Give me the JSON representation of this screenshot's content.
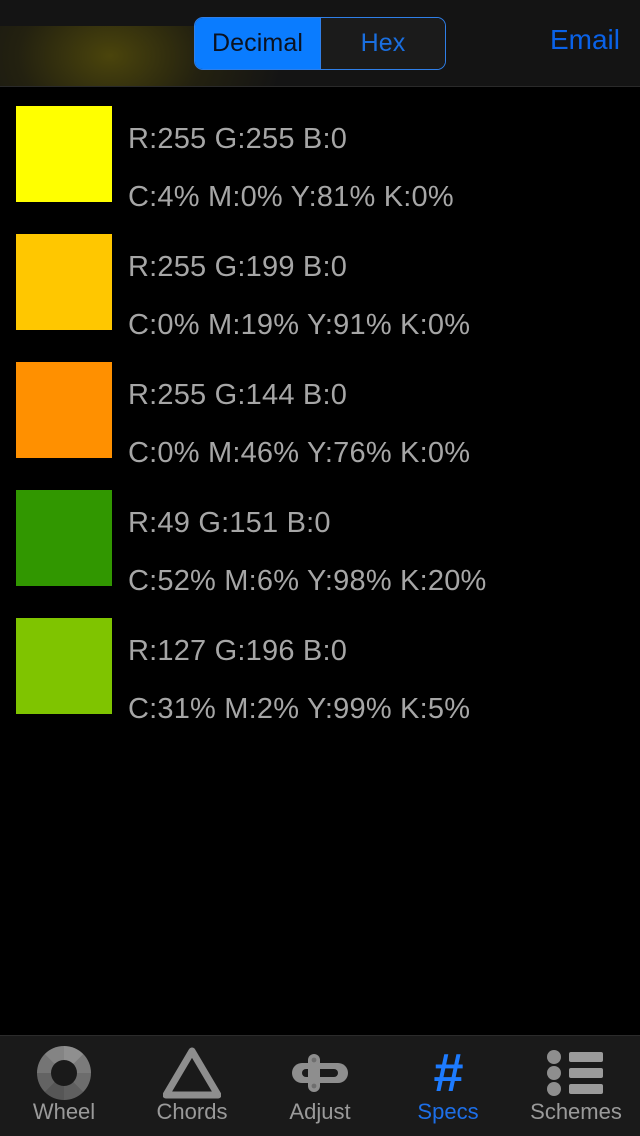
{
  "header": {
    "segmented": {
      "name": "notation-mode",
      "options": [
        {
          "label": "Decimal",
          "selected": true
        },
        {
          "label": "Hex",
          "selected": false
        }
      ]
    },
    "email_label": "Email",
    "accent_color": "#0a7cff",
    "link_color": "#0a62e8",
    "background": "#141414"
  },
  "main": {
    "background": "#000000",
    "text_color": "#a6a6a6",
    "rows": [
      {
        "swatch": "#FFFF00",
        "rgb_line": "R:255 G:255 B:0",
        "cmyk_line": "C:4% M:0% Y:81% K:0%",
        "r": 255,
        "g": 255,
        "b": 0,
        "c": 4,
        "m": 0,
        "y": 81,
        "k": 0
      },
      {
        "swatch": "#FFC700",
        "rgb_line": "R:255 G:199 B:0",
        "cmyk_line": "C:0% M:19% Y:91% K:0%",
        "r": 255,
        "g": 199,
        "b": 0,
        "c": 0,
        "m": 19,
        "y": 91,
        "k": 0
      },
      {
        "swatch": "#FF9000",
        "rgb_line": "R:255 G:144 B:0",
        "cmyk_line": "C:0% M:46% Y:76% K:0%",
        "r": 255,
        "g": 144,
        "b": 0,
        "c": 0,
        "m": 46,
        "y": 76,
        "k": 0
      },
      {
        "swatch": "#319700",
        "rgb_line": "R:49 G:151 B:0",
        "cmyk_line": "C:52% M:6% Y:98% K:20%",
        "r": 49,
        "g": 151,
        "b": 0,
        "c": 52,
        "m": 6,
        "y": 98,
        "k": 20
      },
      {
        "swatch": "#7FC400",
        "rgb_line": "R:127 G:196 B:0",
        "cmyk_line": "C:31% M:2% Y:99% K:5%",
        "r": 127,
        "g": 196,
        "b": 0,
        "c": 31,
        "m": 2,
        "y": 99,
        "k": 5
      }
    ]
  },
  "tabbar": {
    "background": "#1a1a1a",
    "inactive_color": "#9a9a9a",
    "active_color": "#1d6fe8",
    "items": [
      {
        "label": "Wheel",
        "icon": "color-wheel-icon",
        "active": false
      },
      {
        "label": "Chords",
        "icon": "triangle-icon",
        "active": false
      },
      {
        "label": "Adjust",
        "icon": "slider-icon",
        "active": false
      },
      {
        "label": "Specs",
        "icon": "hash-icon",
        "active": true
      },
      {
        "label": "Schemes",
        "icon": "list-icon",
        "active": false
      }
    ]
  }
}
